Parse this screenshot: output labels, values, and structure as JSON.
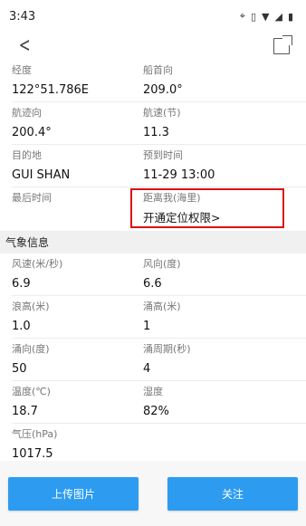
{
  "status_bar": {
    "time": "3:43"
  },
  "nav": {},
  "rows": [
    {
      "left": {
        "label": "经度",
        "value": "122°51.786E"
      },
      "right": {
        "label": "船首向",
        "value": "209.0°"
      }
    },
    {
      "left": {
        "label": "航迹向",
        "value": "200.4°"
      },
      "right": {
        "label": "航速(节)",
        "value": "11.3"
      }
    },
    {
      "left": {
        "label": "目的地",
        "value": "GUI SHAN"
      },
      "right": {
        "label": "预到时间",
        "value": "11-29 13:00"
      }
    },
    {
      "left": {
        "label": "最后时间",
        "value": ""
      },
      "right": {
        "label": "距离我(海里)",
        "value": "开通定位权限>"
      }
    }
  ],
  "weather": {
    "title": "气象信息",
    "rows": [
      {
        "left": {
          "label": "风速(米/秒)",
          "value": "6.9"
        },
        "right": {
          "label": "风向(度)",
          "value": "6.6"
        }
      },
      {
        "left": {
          "label": "浪高(米)",
          "value": "1.0"
        },
        "right": {
          "label": "涌高(米)",
          "value": "1"
        }
      },
      {
        "left": {
          "label": "涌向(度)",
          "value": "50"
        },
        "right": {
          "label": "涌周期(秒)",
          "value": "4"
        }
      },
      {
        "left": {
          "label": "温度(℃)",
          "value": "18.7"
        },
        "right": {
          "label": "湿度",
          "value": "82%"
        }
      },
      {
        "left": {
          "label": "气压(hPa)",
          "value": "1017.5"
        },
        "right": {
          "label": "",
          "value": ""
        }
      }
    ]
  },
  "footer": {
    "upload_label": "上传图片",
    "follow_label": "关注"
  }
}
